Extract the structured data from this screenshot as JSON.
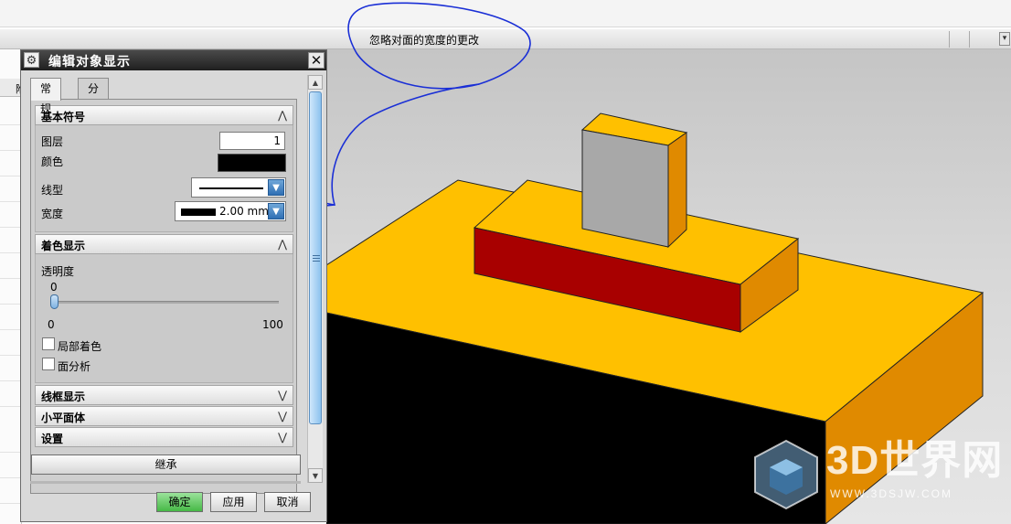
{
  "statusbar": {
    "message": "忽略对面的宽度的更改"
  },
  "navigator": {
    "column_label": "附"
  },
  "dialog": {
    "title": "编辑对象显示",
    "close_label": "✕",
    "tabs": [
      {
        "label": "常规",
        "active": true
      },
      {
        "label": "分析",
        "active": false
      }
    ],
    "basic_section": {
      "header": "基本符号",
      "layer_label": "图层",
      "layer_value": "1",
      "color_label": "颜色",
      "color_value": "#000000",
      "linetype_label": "线型",
      "width_label": "宽度",
      "width_value": "2.00 mm"
    },
    "shading_section": {
      "header": "着色显示",
      "transparency_label": "透明度",
      "transparency_value": "0",
      "slider_min": "0",
      "slider_max": "100",
      "partial_shading_label": "局部着色",
      "face_analysis_label": "面分析"
    },
    "wireframe_header": "线框显示",
    "facet_header": "小平面体",
    "settings_header": "设置",
    "inherit_button": "继承",
    "ok_button": "确定",
    "apply_button": "应用",
    "cancel_button": "取消"
  },
  "watermark": {
    "title": "3D世界网",
    "subtitle": "WWW.3DSJW.COM"
  },
  "colors": {
    "annotation_blue": "#1a2fd6",
    "part_orange_top": "#ffc000",
    "part_orange_side": "#e08a00",
    "part_red": "#a80000",
    "part_gray": "#a8a8a8",
    "ok_green": "#46b946"
  }
}
